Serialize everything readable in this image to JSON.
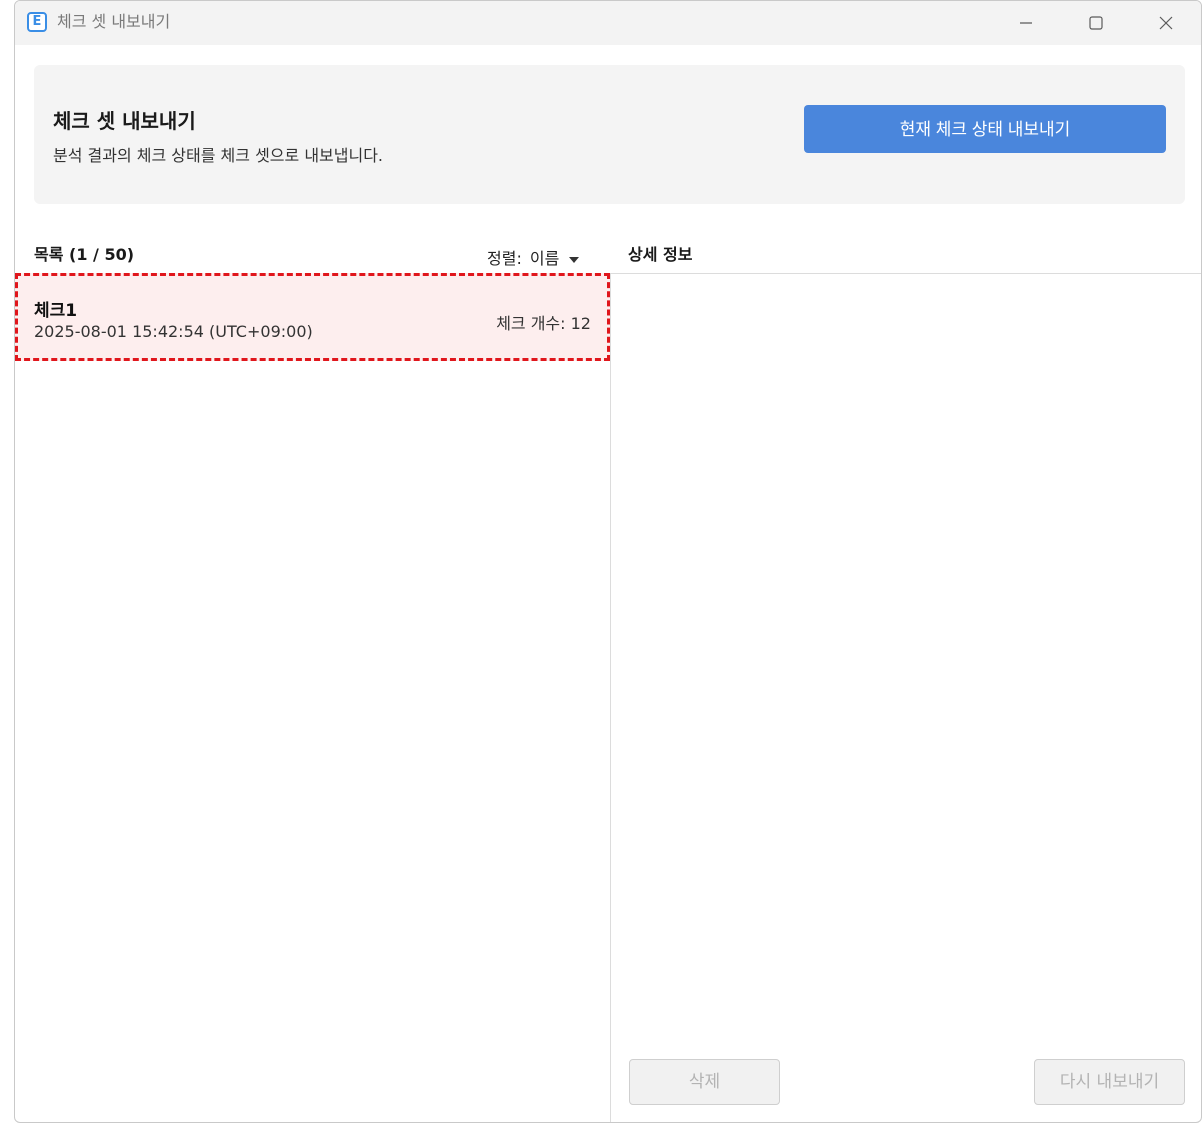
{
  "window": {
    "title": "체크 셋 내보내기",
    "app_icon_letter": "E"
  },
  "header": {
    "title": "체크 셋 내보내기",
    "subtitle": "분석 결과의 체크 상태를 체크 셋으로 내보냅니다.",
    "export_button_label": "현재 체크 상태 내보내기"
  },
  "list": {
    "header": "목록 (1 / 50)",
    "sort_label": "정렬:",
    "sort_value": "이름",
    "items": [
      {
        "name": "체크1",
        "timestamp": "2025-08-01 15:42:54 (UTC+09:00)",
        "count": "체크 개수: 12"
      }
    ]
  },
  "detail": {
    "header": "상세 정보",
    "delete_label": "삭제",
    "reexport_label": "다시 내보내기"
  },
  "colors": {
    "accent": "#4a86dc",
    "selection_border": "#e0161c",
    "selection_bg": "#fdeeee"
  }
}
